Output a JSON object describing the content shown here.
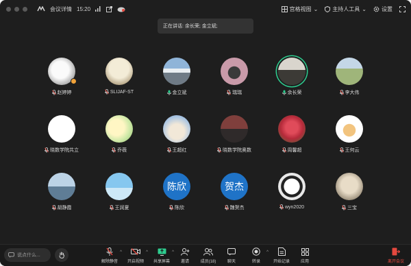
{
  "titlebar": {
    "app_label": "会议详情",
    "time": "15:20",
    "view_label": "宫格视图",
    "host_tools_label": "主持人工具",
    "settings_label": "设置"
  },
  "speaking_banner": "正在讲话: 余长荣; 金立斌;",
  "participants": [
    {
      "name": "赵婷婷",
      "avatar": "photo-anime",
      "badge": true
    },
    {
      "name": "SLIJAF-ST",
      "avatar": "photo-ink"
    },
    {
      "name": "金立斌",
      "avatar": "photo-mountain",
      "speaking": true
    },
    {
      "name": "瑞瑞",
      "avatar": "photo-cat"
    },
    {
      "name": "余长荣",
      "avatar": "photo-person",
      "active": true,
      "speaking": true
    },
    {
      "name": "李大伟",
      "avatar": "photo-field"
    },
    {
      "name": "晓数学院共立",
      "avatar": "photo-logo"
    },
    {
      "name": "乔薇",
      "avatar": "photo-cartoon"
    },
    {
      "name": "王超红",
      "avatar": "photo-flowers"
    },
    {
      "name": "晓数学院奥数",
      "avatar": "photo-group"
    },
    {
      "name": "周馨超",
      "avatar": "photo-bouquet"
    },
    {
      "name": "王何云",
      "avatar": "photo-sticker"
    },
    {
      "name": "胡静霞",
      "avatar": "photo-stones"
    },
    {
      "name": "王润夏",
      "avatar": "photo-sky"
    },
    {
      "name": "陈欣",
      "avatar": "text",
      "avatar_text": "陈欣"
    },
    {
      "name": "魏贺杰",
      "avatar": "text",
      "avatar_text": "贺杰"
    },
    {
      "name": "wyn2020",
      "avatar": "photo-panda"
    },
    {
      "name": "三宝",
      "avatar": "photo-sketch"
    }
  ],
  "chat_placeholder": "说点什么...",
  "toolbar": {
    "mute": "解除静音",
    "video": "开启视频",
    "share": "共享屏幕",
    "invite": "邀请",
    "members": "成员(18)",
    "chat": "聊天",
    "record": "转录",
    "docs": "开始记录",
    "apps": "应用",
    "leave": "离开会议"
  },
  "colors": {
    "accent_green": "#2ecc8f",
    "leave_red": "#e5483e",
    "text_avatar_blue": "#1f73c7"
  }
}
